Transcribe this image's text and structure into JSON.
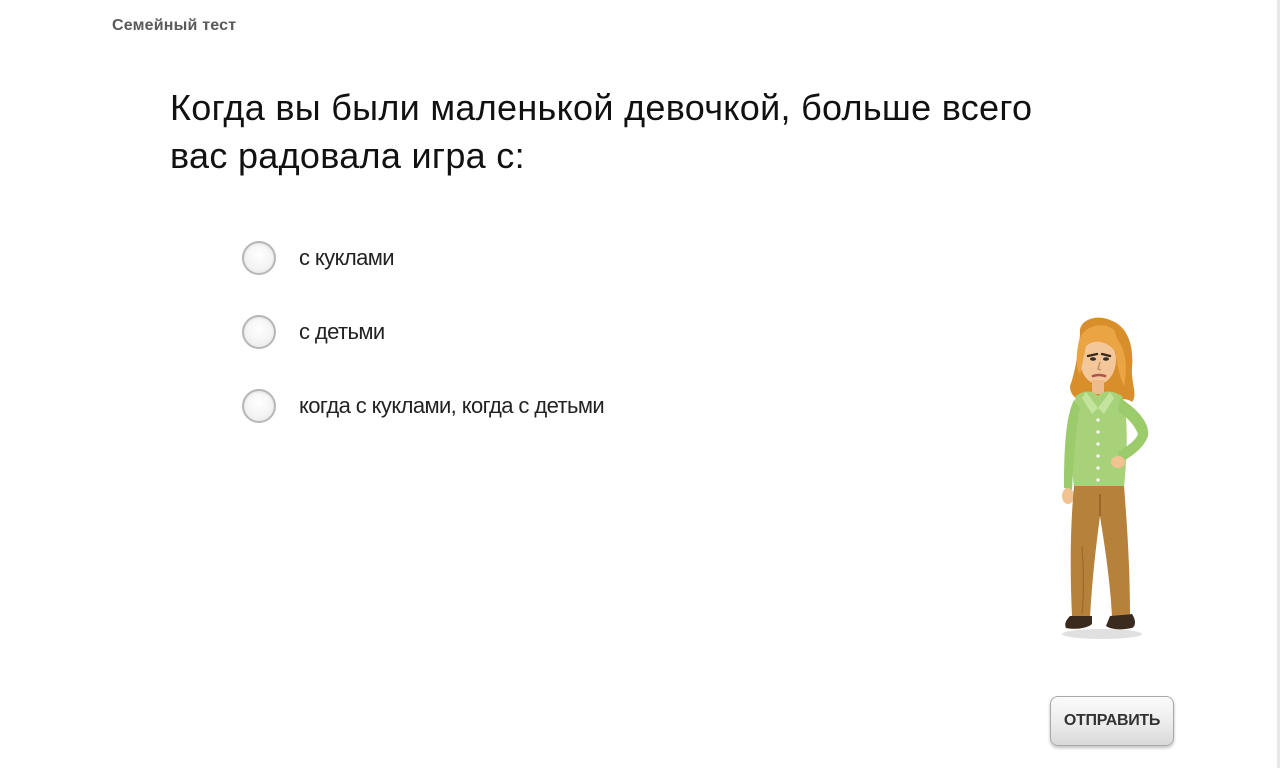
{
  "header": {
    "title": "Семейный тест"
  },
  "question": {
    "text": "Когда вы были маленькой девочкой, больше всего вас радовала игра с:"
  },
  "options": [
    {
      "label": "с куклами",
      "selected": false
    },
    {
      "label": "с детьми",
      "selected": false
    },
    {
      "label": "когда с куклами, когда с детьми",
      "selected": false
    }
  ],
  "submit": {
    "label": "ОТПРАВИТЬ"
  },
  "colors": {
    "blouse": "#a8d27a",
    "trousers": "#b5813b",
    "hair": "#e09a35",
    "button_border": "#a9a9a9"
  }
}
